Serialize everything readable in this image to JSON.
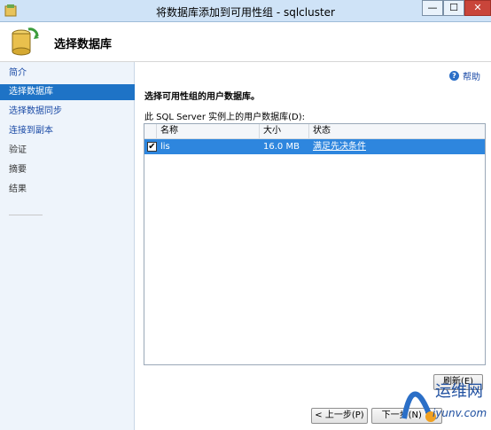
{
  "window": {
    "title": "将数据库添加到可用性组 - sqlcluster",
    "minimize": "—",
    "maximize": "☐",
    "close": "✕"
  },
  "header": {
    "title": "选择数据库"
  },
  "sidebar": {
    "items": [
      {
        "label": "简介",
        "state": "link"
      },
      {
        "label": "选择数据库",
        "state": "active"
      },
      {
        "label": "选择数据同步",
        "state": "link"
      },
      {
        "label": "连接到副本",
        "state": "link"
      },
      {
        "label": "验证",
        "state": "disabled"
      },
      {
        "label": "摘要",
        "state": "disabled"
      },
      {
        "label": "结果",
        "state": "disabled"
      }
    ]
  },
  "main": {
    "help_label": "帮助",
    "section_title": "选择可用性组的用户数据库。",
    "grid_label": "此 SQL Server 实例上的用户数据库(D):",
    "columns": [
      "名称",
      "大小",
      "状态"
    ],
    "rows": [
      {
        "checked": true,
        "name": "lis",
        "size": "16.0 MB",
        "status": "满足先决条件"
      }
    ]
  },
  "buttons": {
    "refresh": "刷新(E)",
    "prev": "< 上一步(P)",
    "next": "下一步(N) >"
  },
  "watermark": {
    "cn": "运维网",
    "url": "iyunv.com"
  }
}
